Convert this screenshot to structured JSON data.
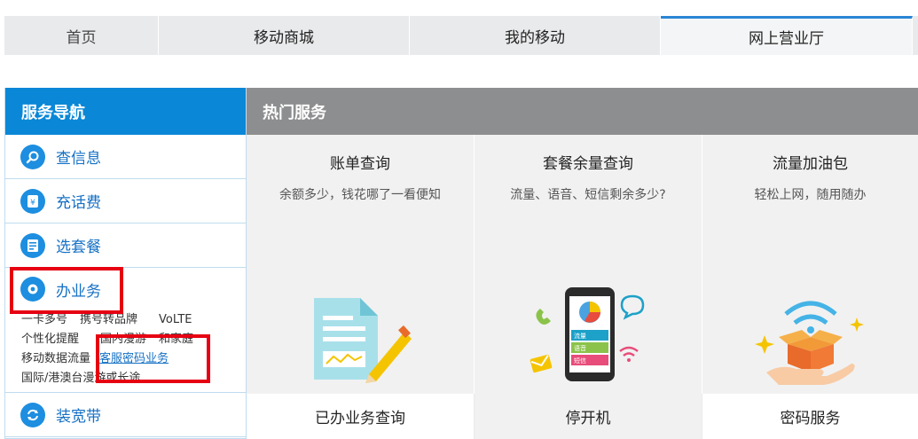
{
  "topnav": {
    "tabs": [
      {
        "label": "首页"
      },
      {
        "label": "移动商城"
      },
      {
        "label": "我的移动"
      },
      {
        "label": "网上营业厅"
      }
    ]
  },
  "sidebar": {
    "title": "服务导航",
    "items": [
      {
        "label": "查信息",
        "icon": "search-icon"
      },
      {
        "label": "充话费",
        "icon": "wallet-icon"
      },
      {
        "label": "选套餐",
        "icon": "package-icon"
      },
      {
        "label": "办业务",
        "icon": "gear-icon"
      },
      {
        "label": "装宽带",
        "icon": "broadband-icon"
      }
    ],
    "business_links": {
      "row1": [
        "一卡多号",
        "携号转品牌",
        "VoLTE"
      ],
      "row2": [
        "个性化提醒",
        "国内漫游",
        "和家庭"
      ],
      "row3": [
        "移动数据流量",
        "客服密码业务"
      ],
      "row4": [
        "国际/港澳台漫游或长途"
      ]
    }
  },
  "hot": {
    "title": "热门服务",
    "cards": [
      {
        "title": "账单查询",
        "desc": "余额多少，钱花哪了一看便知"
      },
      {
        "title": "套餐余量查询",
        "desc": "流量、语音、短信剩余多少?"
      },
      {
        "title": "流量加油包",
        "desc": "轻松上网，随用随办"
      }
    ],
    "phone_labels": [
      "流量",
      "语音",
      "短信"
    ],
    "bottom": [
      "已办业务查询",
      "停开机",
      "密码服务"
    ]
  },
  "colors": {
    "accent": "#0a87d7",
    "highlight": "#e60012",
    "link": "#1570c4"
  }
}
